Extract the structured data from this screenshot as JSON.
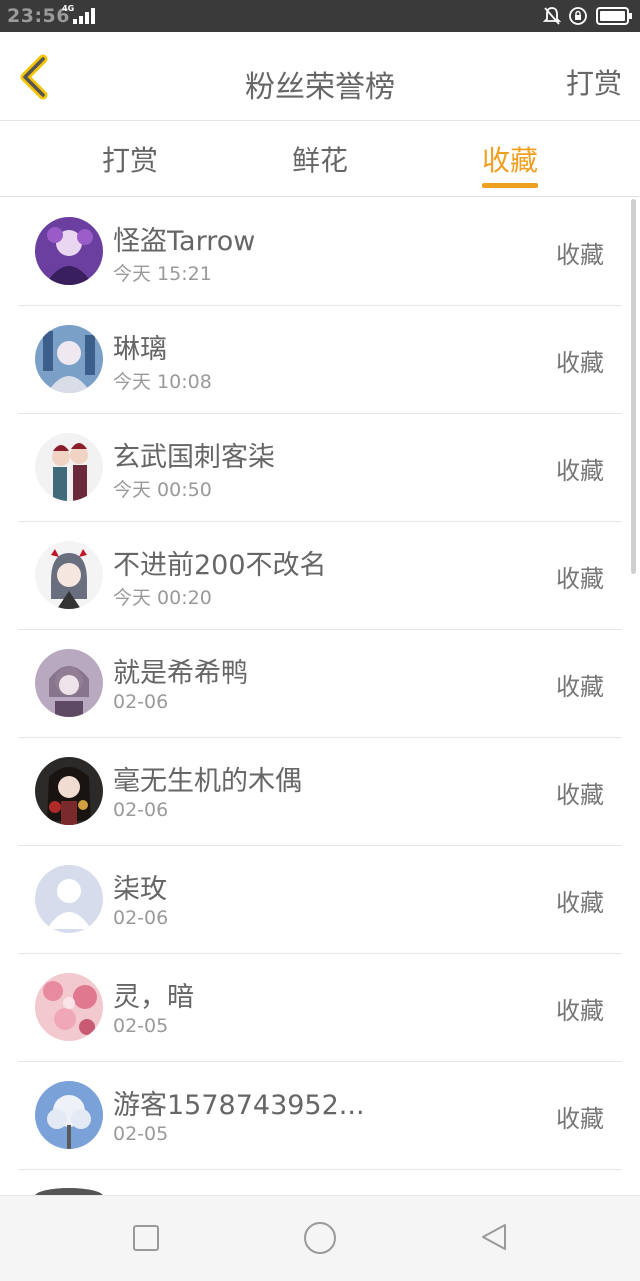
{
  "status": {
    "time": "23:56",
    "network": "4G"
  },
  "header": {
    "title": "粉丝荣誉榜",
    "right_action": "打赏"
  },
  "tabs": [
    {
      "label": "打赏",
      "active": false
    },
    {
      "label": "鲜花",
      "active": false
    },
    {
      "label": "收藏",
      "active": true
    }
  ],
  "accent_color": "#f0a020",
  "rows": [
    {
      "name": "怪盗Tarrow",
      "time": "今天 15:21",
      "action": "收藏"
    },
    {
      "name": "琳璃",
      "time": "今天 10:08",
      "action": "收藏"
    },
    {
      "name": "玄武国刺客柒",
      "time": "今天 00:50",
      "action": "收藏"
    },
    {
      "name": "不进前200不改名",
      "time": "今天 00:20",
      "action": "收藏"
    },
    {
      "name": "就是希希鸭",
      "time": "02-06",
      "action": "收藏"
    },
    {
      "name": "毫无生机的木偶",
      "time": "02-06",
      "action": "收藏"
    },
    {
      "name": "柒玫",
      "time": "02-06",
      "action": "收藏"
    },
    {
      "name": "灵，暗",
      "time": "02-05",
      "action": "收藏"
    },
    {
      "name": "游客1578743952...",
      "time": "02-05",
      "action": "收藏"
    }
  ]
}
